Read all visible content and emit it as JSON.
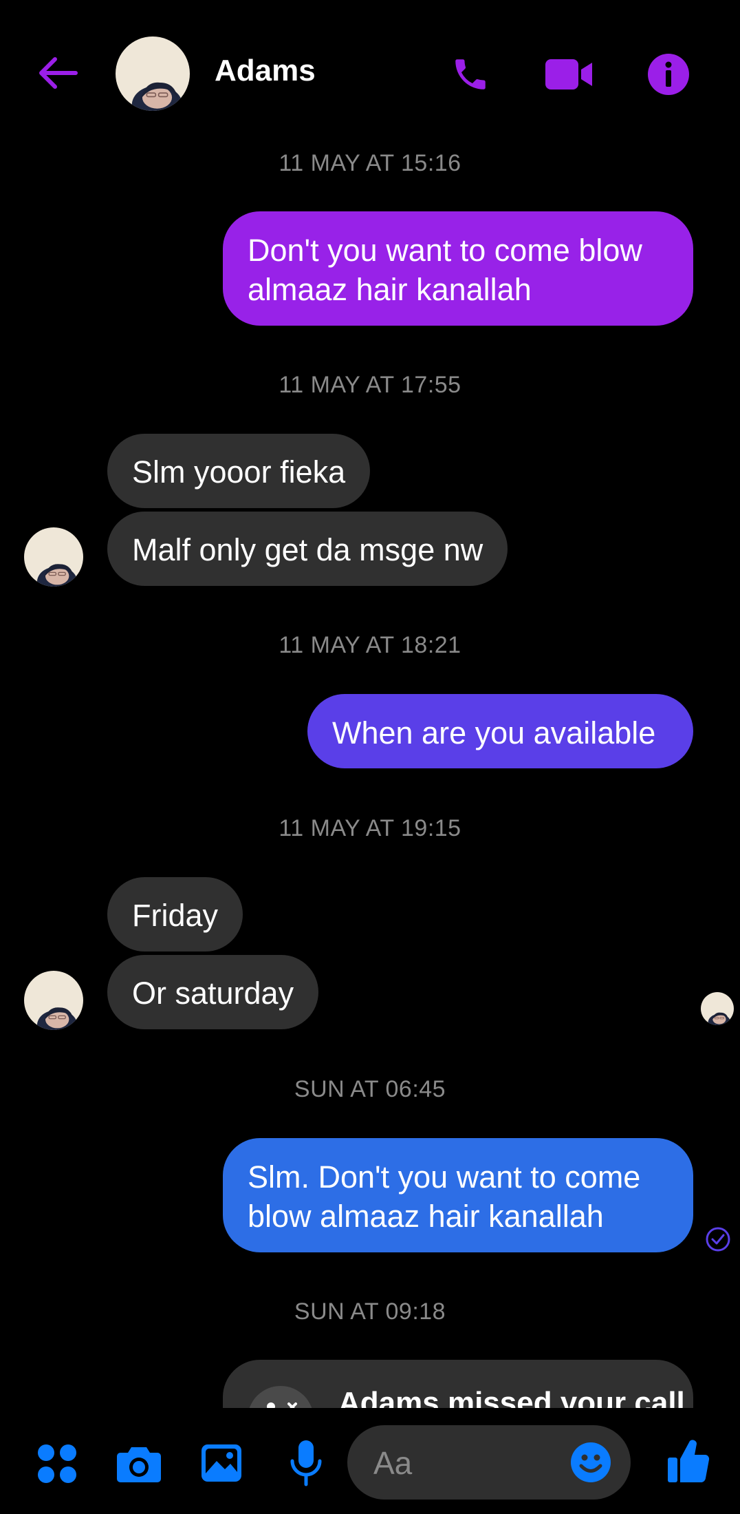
{
  "header": {
    "contact_name": "Adams"
  },
  "messages": [
    {
      "type": "timestamp",
      "text": "11 MAY AT 15:16"
    },
    {
      "type": "outgoing",
      "text": "Don't you want to come blow almaaz hair kanallah"
    },
    {
      "type": "timestamp",
      "text": "11 MAY AT 17:55"
    },
    {
      "type": "incoming",
      "text": "Slm yooor fieka"
    },
    {
      "type": "incoming",
      "text": "Malf only get da msge nw"
    },
    {
      "type": "timestamp",
      "text": "11 MAY AT 18:21"
    },
    {
      "type": "outgoing",
      "text": "When are you available"
    },
    {
      "type": "timestamp",
      "text": "11 MAY AT 19:15"
    },
    {
      "type": "incoming",
      "text": "Friday"
    },
    {
      "type": "incoming",
      "text": "Or saturday"
    },
    {
      "type": "timestamp",
      "text": "SUN AT 06:45"
    },
    {
      "type": "outgoing",
      "text": "Slm. Don't you want to come blow almaaz hair kanallah",
      "status": "delivered"
    },
    {
      "type": "timestamp",
      "text": "SUN AT 09:18"
    },
    {
      "type": "call",
      "text": "Adams missed your call"
    }
  ],
  "composer": {
    "placeholder": "Aa"
  },
  "icons": {
    "back": "back-arrow-icon",
    "call": "phone-icon",
    "video": "video-camera-icon",
    "info": "info-icon",
    "apps": "apps-grid-icon",
    "camera": "camera-icon",
    "gallery": "image-icon",
    "mic": "microphone-icon",
    "emoji": "emoji-icon",
    "like": "thumbs-up-icon"
  },
  "colors": {
    "background": "#000000",
    "header_accent": "#9b1fe8",
    "bubble_purple": "#9822e8",
    "bubble_indigo": "#5a3fe8",
    "bubble_blue": "#2d6ee6",
    "incoming_bubble": "#303030",
    "toolbar_blue": "#0a7cff",
    "timestamp": "#8a8a8a"
  }
}
